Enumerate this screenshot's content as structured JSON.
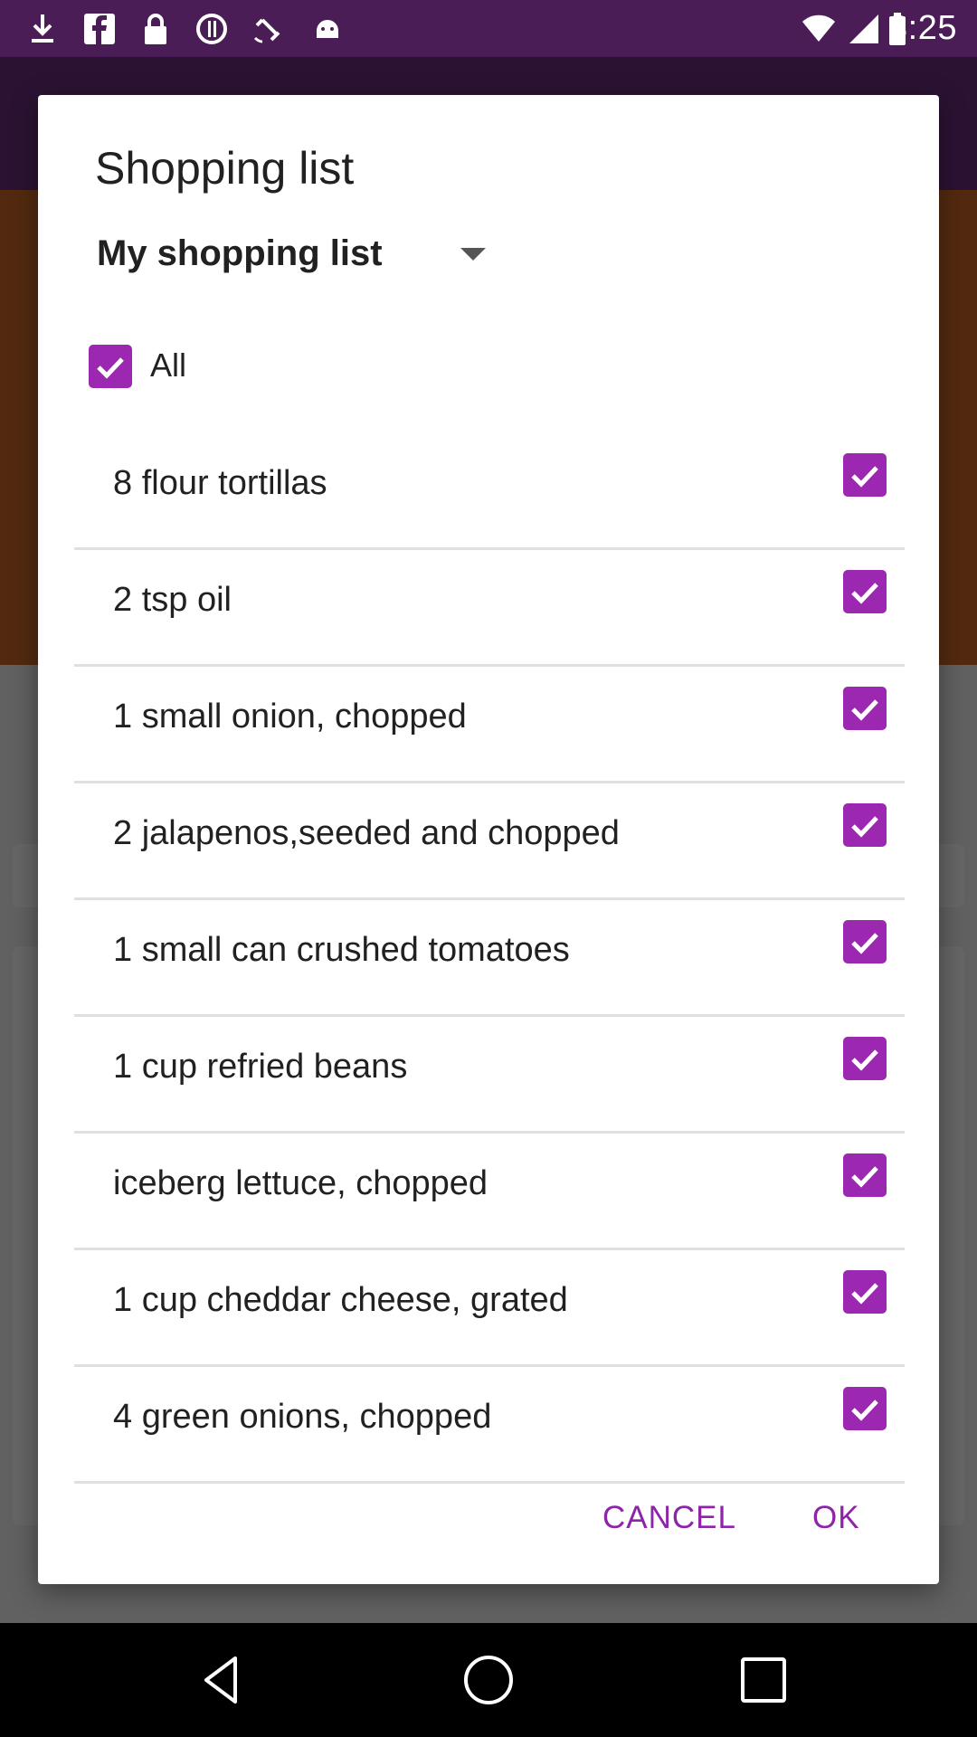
{
  "status_bar": {
    "time": "3:25",
    "icons": [
      "download-icon",
      "facebook-icon",
      "lock-icon",
      "blocked-icon",
      "satellite-icon",
      "android-icon"
    ],
    "right_icons": [
      "wifi-icon",
      "signal-icon",
      "battery-icon"
    ]
  },
  "dialog": {
    "title": "Shopping list",
    "list_select": {
      "value": "My shopping list"
    },
    "select_all": {
      "label": "All",
      "checked": true
    },
    "items": [
      {
        "label": "8 flour tortillas",
        "checked": true
      },
      {
        "label": "2 tsp oil",
        "checked": true
      },
      {
        "label": "1 small onion, chopped",
        "checked": true
      },
      {
        "label": "2 jalapenos,seeded and chopped",
        "checked": true
      },
      {
        "label": "1 small can crushed tomatoes",
        "checked": true
      },
      {
        "label": "1 cup refried beans",
        "checked": true
      },
      {
        "label": "iceberg lettuce, chopped",
        "checked": true
      },
      {
        "label": "1 cup cheddar cheese, grated",
        "checked": true
      },
      {
        "label": "4 green onions, chopped",
        "checked": true
      }
    ],
    "buttons": {
      "cancel": "CANCEL",
      "ok": "OK"
    }
  },
  "nav_bar": {
    "icons": [
      "back-icon",
      "home-icon",
      "recents-icon"
    ]
  },
  "colors": {
    "accent": "#9c27b0",
    "button_text": "#8e24aa",
    "app_toolbar": "#6c2f80",
    "status_bar": "#4a1d57"
  }
}
